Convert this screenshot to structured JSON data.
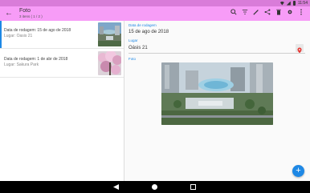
{
  "status_bar": {
    "time": "11:54"
  },
  "toolbar": {
    "title": "Foto",
    "subtitle": "3 itens ( 1 / 2 )",
    "back_icon": "arrow-back-icon",
    "actions": [
      "search-icon",
      "filter-icon",
      "edit-icon",
      "share-icon",
      "delete-icon",
      "settings-icon",
      "more-vert-icon"
    ]
  },
  "list": {
    "items": [
      {
        "title": "Data de rodagem: 15 de ago de 2018",
        "place": "Lugar: Oasis 21",
        "selected": true
      },
      {
        "title": "Data de rodagem: 1 de abr de 2018",
        "place": "Lugar: Sakura Park",
        "selected": false
      }
    ]
  },
  "detail": {
    "date_label": "Data de rodagem",
    "date_value": "15 de ago de 2018",
    "place_label": "Lugar",
    "place_value": "Oásis 21",
    "photo_label": "Foto"
  },
  "colors": {
    "toolbar": "#f79cf7",
    "accent": "#1e88e5",
    "fab": "#1e88e5"
  },
  "fab": {
    "icon": "add-icon",
    "label": "+"
  }
}
